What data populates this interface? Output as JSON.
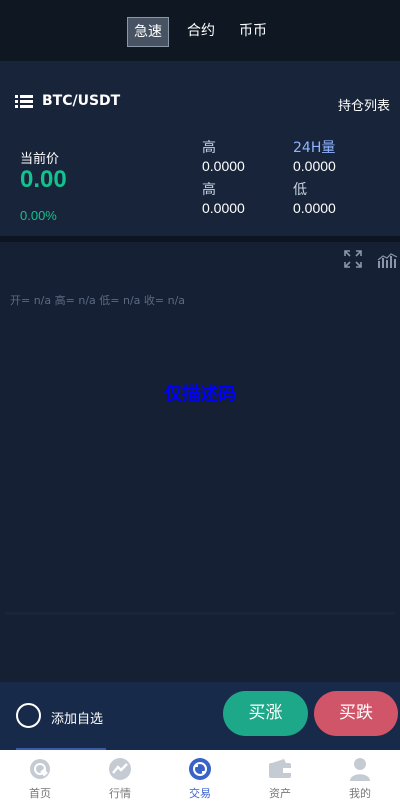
{
  "tabs": [
    {
      "label": "急速",
      "active": true
    },
    {
      "label": "合约",
      "active": false
    },
    {
      "label": "币币",
      "active": false
    }
  ],
  "ticker": {
    "pair": "BTC/USDT",
    "positions_label": "持仓列表",
    "price_label": "当前价",
    "price": "0.00",
    "change": "0.00%",
    "stats": {
      "high1_label": "高",
      "high1_value": "0.0000",
      "vol_label": "24H量",
      "vol_value": "0.0000",
      "high2_label": "高",
      "high2_value": "0.0000",
      "low_label": "低",
      "low_value": "0.0000"
    }
  },
  "chart": {
    "ohlc": "开= n/a  高= n/a  低= n/a  收= n/a",
    "error_text": "仅描述码"
  },
  "action": {
    "favorite_label": "添加自选",
    "buy_up_label": "买涨",
    "buy_down_label": "买跌"
  },
  "nav": [
    {
      "label": "首页",
      "icon": "home-icon",
      "active": false
    },
    {
      "label": "行情",
      "icon": "market-icon",
      "active": false
    },
    {
      "label": "交易",
      "icon": "trade-icon",
      "active": true
    },
    {
      "label": "资产",
      "icon": "wallet-icon",
      "active": false
    },
    {
      "label": "我的",
      "icon": "user-icon",
      "active": false
    }
  ],
  "colors": {
    "up": "#1ea88a",
    "down": "#d15568",
    "price": "#13c28c",
    "nav_active": "#3a63c9"
  }
}
